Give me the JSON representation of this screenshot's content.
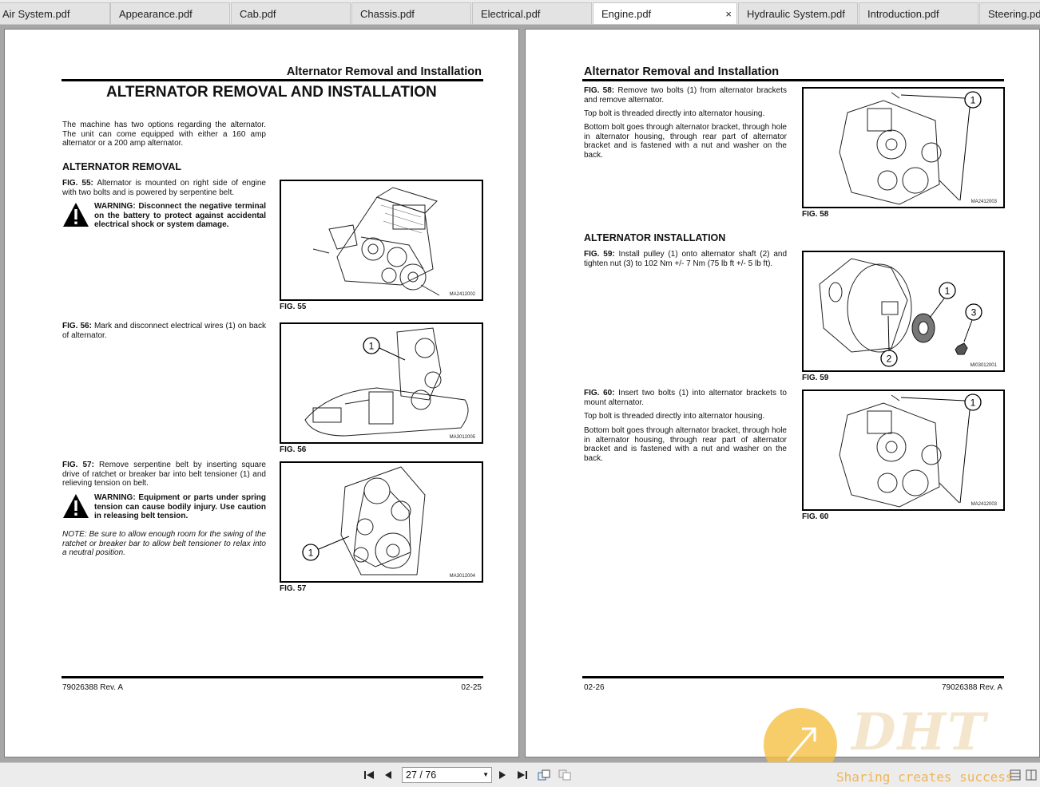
{
  "tabs": [
    {
      "label": "Air System.pdf"
    },
    {
      "label": "Appearance.pdf"
    },
    {
      "label": "Cab.pdf"
    },
    {
      "label": "Chassis.pdf"
    },
    {
      "label": "Electrical.pdf"
    },
    {
      "label": "Engine.pdf",
      "active": true,
      "close": "×"
    },
    {
      "label": "Hydraulic System.pdf"
    },
    {
      "label": "Introduction.pdf"
    },
    {
      "label": "Steering.pdf"
    }
  ],
  "left_page": {
    "header": "Alternator Removal and Installation",
    "title": "ALTERNATOR REMOVAL AND INSTALLATION",
    "intro": "The machine has two options regarding the alternator. The unit can come equipped with either a 160 amp alternator or a 200 amp alternator.",
    "section": "ALTERNATOR REMOVAL",
    "fig55_label": "FIG. 55:",
    "fig55_text": "Alternator is mounted on right side of engine with two bolts and is powered by serpentine belt.",
    "warning1": "WARNING: Disconnect the negative terminal on the battery to protect against accidental electrical shock or system damage.",
    "fig56_label": "FIG. 56:",
    "fig56_text": "Mark and disconnect electrical wires (1) on back of alternator.",
    "fig57_label": "FIG. 57:",
    "fig57_text": "Remove serpentine belt by inserting square drive of ratchet or breaker bar into belt tensioner (1) and relieving tension on belt.",
    "warning2": "WARNING: Equipment or parts under spring tension can cause bodily injury. Use caution in releasing belt tension.",
    "note": "NOTE:  Be sure to allow enough room for the swing of the ratchet or breaker bar to allow belt tensioner to relax into a neutral position.",
    "fig55_caption": "FIG. 55",
    "fig55_code": "MA2412002",
    "fig56_caption": "FIG. 56",
    "fig56_code": "MA3012005",
    "fig57_caption": "FIG. 57",
    "fig57_code": "MA3012004",
    "footer_left": "79026388 Rev. A",
    "footer_right": "02-25"
  },
  "right_page": {
    "header": "Alternator Removal and Installation",
    "fig58_label": "FIG. 58:",
    "fig58_text": "Remove two bolts (1) from alternator brackets and remove alternator.",
    "fig58_text2": "Top bolt is threaded directly into alternator housing.",
    "fig58_text3": "Bottom bolt goes through alternator bracket, through hole in alternator housing, through rear part of alternator bracket and is fastened with a nut and washer on the back.",
    "section": "ALTERNATOR INSTALLATION",
    "fig59_label": "FIG. 59:",
    "fig59_text": "Install pulley (1) onto alternator shaft (2) and tighten nut (3) to 102 Nm +/- 7 Nm (75 lb ft +/- 5 lb ft).",
    "fig60_label": "FIG. 60:",
    "fig60_text": "Insert two bolts (1) into alternator brackets to mount alternator.",
    "fig60_text2": "Top bolt is threaded directly into alternator housing.",
    "fig60_text3": "Bottom bolt goes through alternator bracket, through hole in alternator housing, through rear part of alternator bracket and is fastened with a nut and washer on the back.",
    "fig58_caption": "FIG. 58",
    "fig58_code": "MA2412003",
    "fig59_caption": "FIG. 59",
    "fig59_code": "MI03012001",
    "fig60_caption": "FIG. 60",
    "fig60_code": "MA2412003",
    "footer_left": "02-26",
    "footer_right": "79026388 Rev. A"
  },
  "callouts": {
    "one": "1",
    "two": "2",
    "three": "3"
  },
  "toolbar": {
    "page_indicator": "27 / 76"
  },
  "watermark": {
    "logo": "DHT",
    "slogan": "Sharing creates success"
  }
}
